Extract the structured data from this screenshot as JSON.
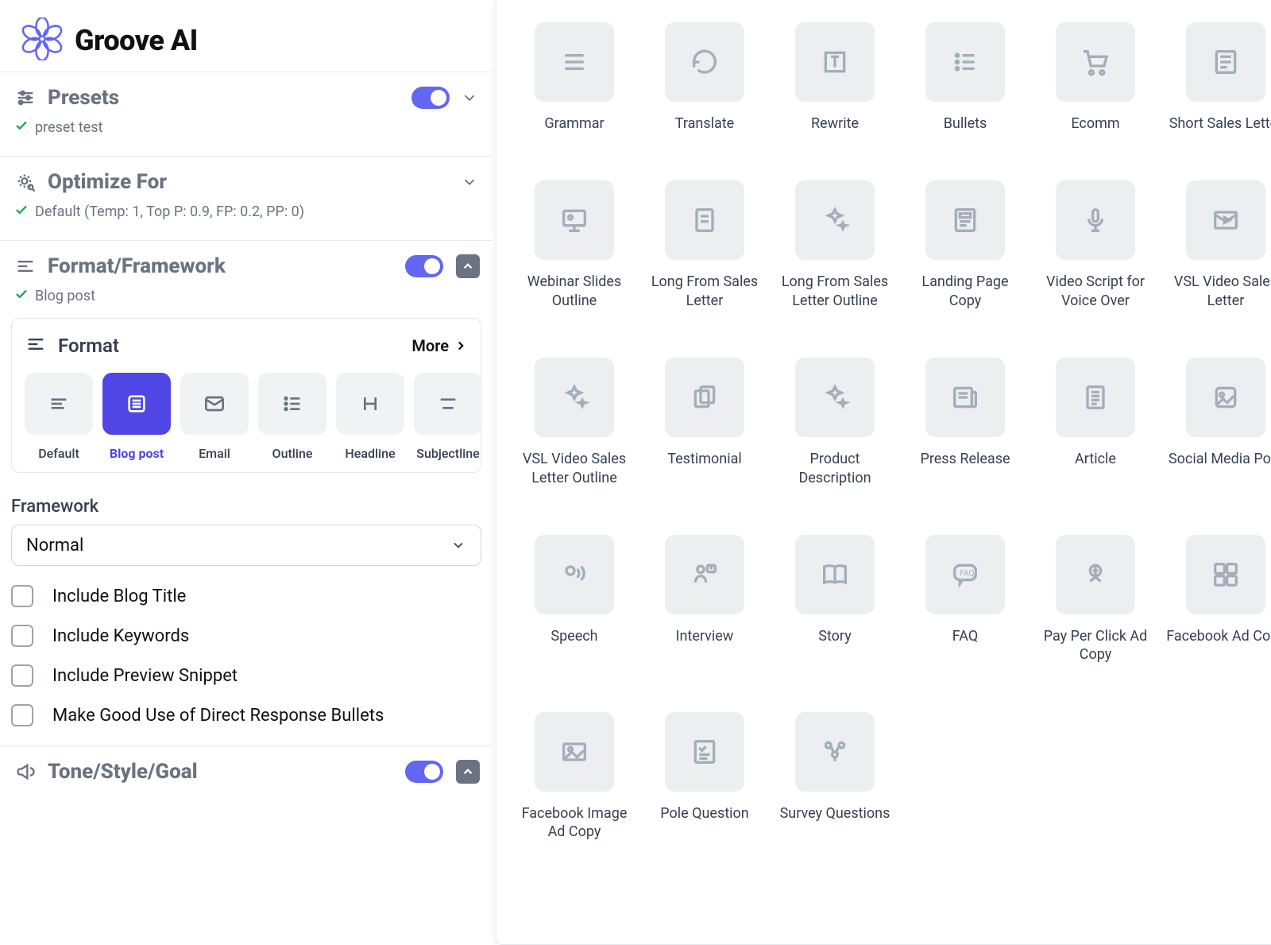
{
  "brand": {
    "name": "Groove AI"
  },
  "presets": {
    "title": "Presets",
    "status": "preset test"
  },
  "optimize": {
    "title": "Optimize For",
    "status": "Default (Temp: 1, Top P: 0.9, FP: 0.2, PP: 0)"
  },
  "formatFramework": {
    "title": "Format/Framework",
    "status": "Blog post"
  },
  "format": {
    "heading": "Format",
    "more": "More",
    "tiles": [
      {
        "label": "Default"
      },
      {
        "label": "Blog post"
      },
      {
        "label": "Email"
      },
      {
        "label": "Outline"
      },
      {
        "label": "Headline"
      },
      {
        "label": "Subjectline"
      }
    ]
  },
  "framework": {
    "label": "Framework",
    "value": "Normal"
  },
  "options": [
    "Include Blog Title",
    "Include Keywords",
    "Include Preview Snippet",
    "Make Good Use of Direct Response Bullets"
  ],
  "tone": {
    "title": "Tone/Style/Goal"
  },
  "grid": [
    {
      "icon": "lines",
      "label": "Grammar"
    },
    {
      "icon": "refresh",
      "label": "Translate"
    },
    {
      "icon": "textbox",
      "label": "Rewrite"
    },
    {
      "icon": "bullets",
      "label": "Bullets"
    },
    {
      "icon": "cart",
      "label": "Ecomm"
    },
    {
      "icon": "letter",
      "label": "Short Sales Letter"
    },
    {
      "icon": "presentation",
      "label": "Webinar Slides Outline"
    },
    {
      "icon": "doc-sale",
      "label": "Long From Sales Letter"
    },
    {
      "icon": "sparkles",
      "label": "Long From Sales Letter Outline"
    },
    {
      "icon": "landing",
      "label": "Landing Page Copy"
    },
    {
      "icon": "mic",
      "label": "Video Script for Voice Over"
    },
    {
      "icon": "envelope-play",
      "label": "VSL Video Sales Letter"
    },
    {
      "icon": "sparkles",
      "label": "VSL Video Sales Letter Outline"
    },
    {
      "icon": "cards",
      "label": "Testimonial"
    },
    {
      "icon": "sparkles",
      "label": "Product Description"
    },
    {
      "icon": "press",
      "label": "Press Release"
    },
    {
      "icon": "article",
      "label": "Article"
    },
    {
      "icon": "social",
      "label": "Social Media Post"
    },
    {
      "icon": "speech",
      "label": "Speech"
    },
    {
      "icon": "interview",
      "label": "Interview"
    },
    {
      "icon": "book",
      "label": "Story"
    },
    {
      "icon": "faq",
      "label": "FAQ"
    },
    {
      "icon": "ppc",
      "label": "Pay Per Click Ad Copy"
    },
    {
      "icon": "fb-ad",
      "label": "Facebook Ad Copy"
    },
    {
      "icon": "image",
      "label": "Facebook Image Ad Copy"
    },
    {
      "icon": "checklist",
      "label": "Pole Question"
    },
    {
      "icon": "survey",
      "label": "Survey Questions"
    }
  ]
}
